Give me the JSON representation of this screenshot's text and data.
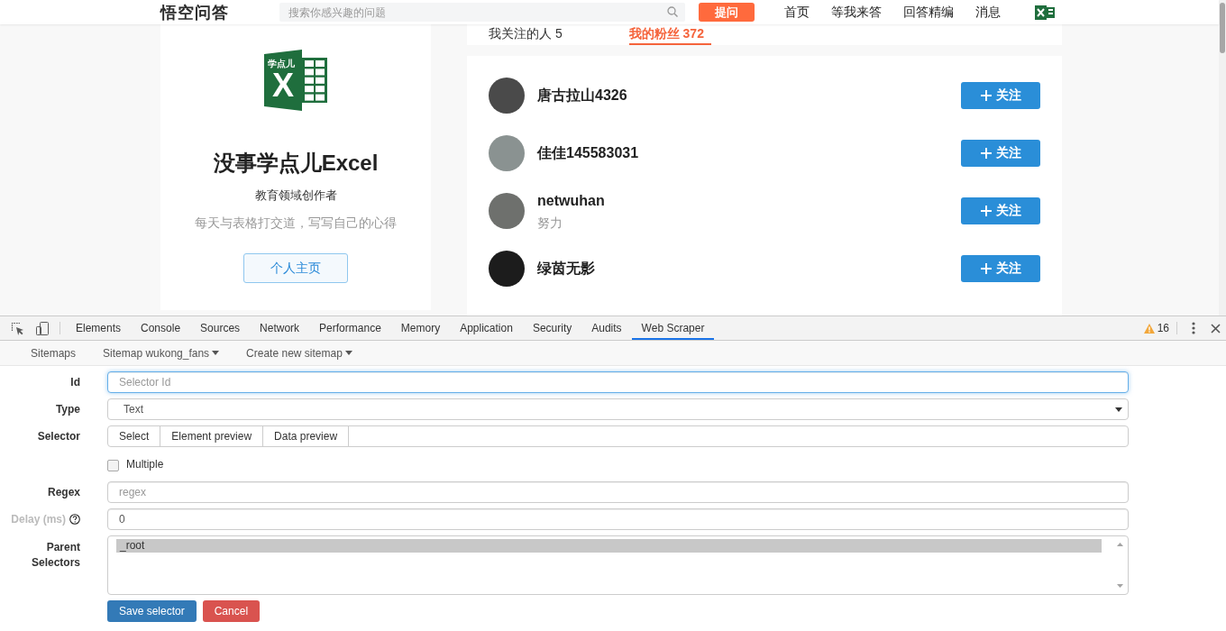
{
  "header": {
    "logo": "悟空问答",
    "search": {
      "placeholder": "搜索你感兴趣的问题"
    },
    "ask_button": "提问",
    "nav": [
      "首页",
      "等我来答",
      "回答精编",
      "消息"
    ]
  },
  "profile_card": {
    "logo": {
      "badge": "学点儿",
      "letter": "X"
    },
    "name": "没事学点儿Excel",
    "role": "教育领域创作者",
    "bio": "每天与表格打交道，写写自己的心得",
    "button": "个人主页"
  },
  "tabs": [
    {
      "label": "我关注的人 5",
      "selected": false
    },
    {
      "label": "我的粉丝 372",
      "selected": true
    }
  ],
  "followers": [
    {
      "name": "唐古拉山4326",
      "button": "关注"
    },
    {
      "name": "佳佳145583031",
      "button": "关注"
    },
    {
      "name": "netwuhan",
      "bio": "努力",
      "button": "关注"
    },
    {
      "name": "绿茵无影",
      "button": "关注"
    }
  ],
  "devtools": {
    "tabs": [
      {
        "label": "Elements",
        "selected": false
      },
      {
        "label": "Console",
        "selected": false
      },
      {
        "label": "Sources",
        "selected": false
      },
      {
        "label": "Network",
        "selected": false
      },
      {
        "label": "Performance",
        "selected": false
      },
      {
        "label": "Memory",
        "selected": false
      },
      {
        "label": "Application",
        "selected": false
      },
      {
        "label": "Security",
        "selected": false
      },
      {
        "label": "Audits",
        "selected": false
      },
      {
        "label": "Web Scraper",
        "selected": true
      }
    ],
    "warnings": "16"
  },
  "scraper": {
    "nav": [
      {
        "label": "Sitemaps",
        "dropdown": false
      },
      {
        "label": "Sitemap wukong_fans",
        "dropdown": true
      },
      {
        "label": "Create new sitemap",
        "dropdown": true
      }
    ],
    "form": {
      "fields": [
        {
          "kind": "input",
          "label": "Id",
          "placeholder": "Selector Id",
          "focused": true,
          "muted": false,
          "help": false
        },
        {
          "kind": "select",
          "label": "Type",
          "value": "Text",
          "muted": false,
          "help": false
        },
        {
          "kind": "selector",
          "label": "Selector",
          "buttons": [
            "Select",
            "Element preview",
            "Data preview"
          ],
          "muted": false,
          "help": false
        },
        {
          "kind": "checkbox",
          "label": "Multiple",
          "checked": false,
          "muted": false,
          "help": false
        },
        {
          "kind": "input",
          "label": "Regex",
          "placeholder": "regex",
          "focused": false,
          "muted": false,
          "help": false
        },
        {
          "kind": "input",
          "label": "Delay (ms)",
          "value": "0",
          "focused": false,
          "muted": true,
          "help": true
        },
        {
          "kind": "multiselect",
          "label": "Parent Selectors",
          "options": [
            {
              "label": "_root",
              "selected": true
            }
          ],
          "muted": false,
          "help": false
        }
      ],
      "actions": [
        {
          "label": "Save selector",
          "kind": "primary"
        },
        {
          "label": "Cancel",
          "kind": "danger"
        }
      ]
    }
  }
}
